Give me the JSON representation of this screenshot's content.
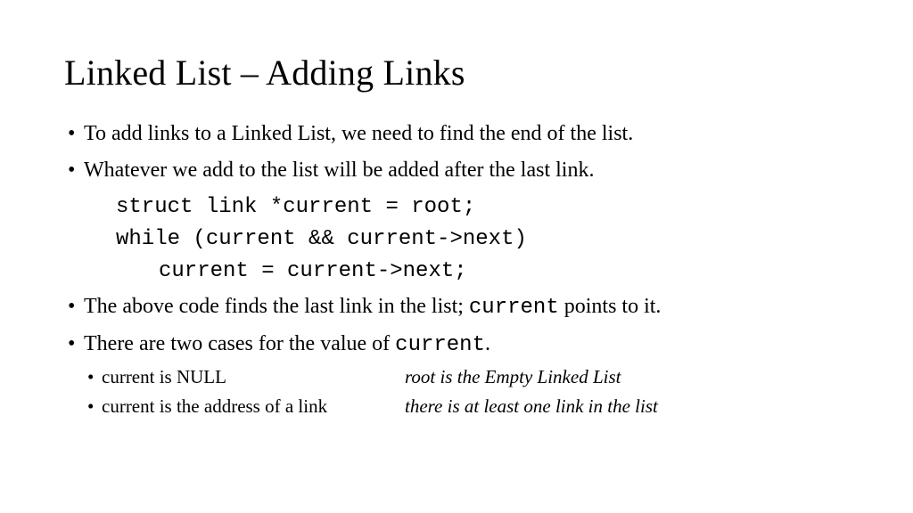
{
  "title": "Linked List – Adding Links",
  "bullets": {
    "b1": "To add links to a Linked List, we need to find the end of the list.",
    "b2": "Whatever we add to the list will be added after the last link.",
    "b3_pre": "The above code finds the last link in the list; ",
    "b3_code": "current",
    "b3_post": " points to it.",
    "b4_pre": "There are two cases for the value of ",
    "b4_code": "current",
    "b4_post": "."
  },
  "code": {
    "l1": "struct link *current = root;",
    "l2": "while (current && current->next)",
    "l3": "current = current->next;"
  },
  "cases": {
    "c1_left": "current is NULL",
    "c1_right": "root is the Empty Linked List",
    "c2_left": "current is the address of a link",
    "c2_right": "there is at least one link in the list"
  }
}
